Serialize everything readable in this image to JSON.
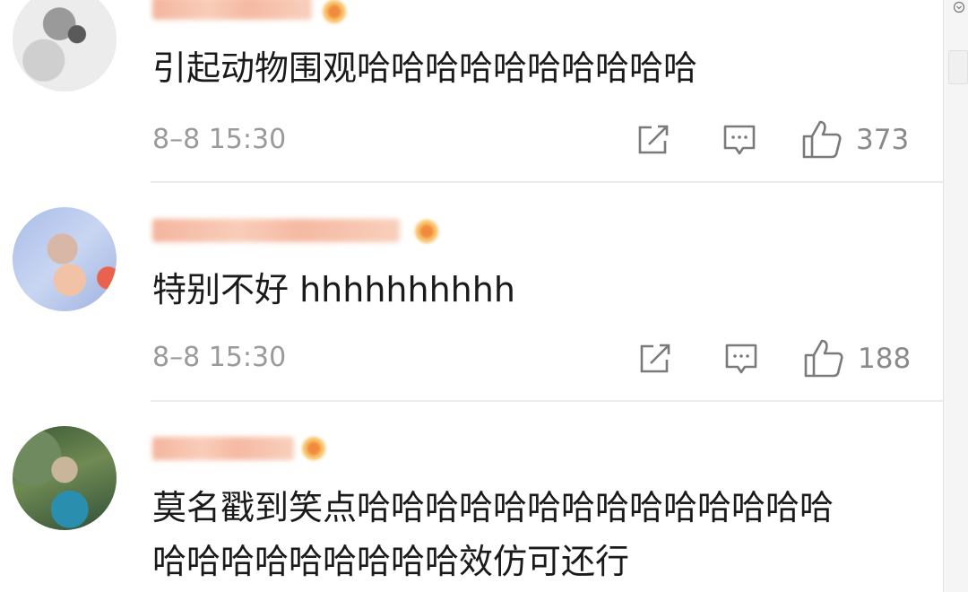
{
  "comments": [
    {
      "text": "引起动物围观哈哈哈哈哈哈哈哈哈哈",
      "time": "8–8 15:30",
      "likes": "373"
    },
    {
      "text": "特别不好 hhhhhhhhhh",
      "time": "8–8 15:30",
      "likes": "188"
    },
    {
      "text_line1": "莫名戳到笑点哈哈哈哈哈哈哈哈哈哈哈哈哈哈",
      "text_line2": "哈哈哈哈哈哈哈哈哈效仿可还行"
    }
  ],
  "icons": {
    "repost": "share-box-icon",
    "comment": "comment-bubble-icon",
    "like": "thumbs-up-icon",
    "badge": "vip-badge-icon"
  },
  "colors": {
    "text": "#1a1a1a",
    "meta": "#9a9a9a",
    "icon": "#7a7a7a",
    "divider": "#ececec"
  }
}
